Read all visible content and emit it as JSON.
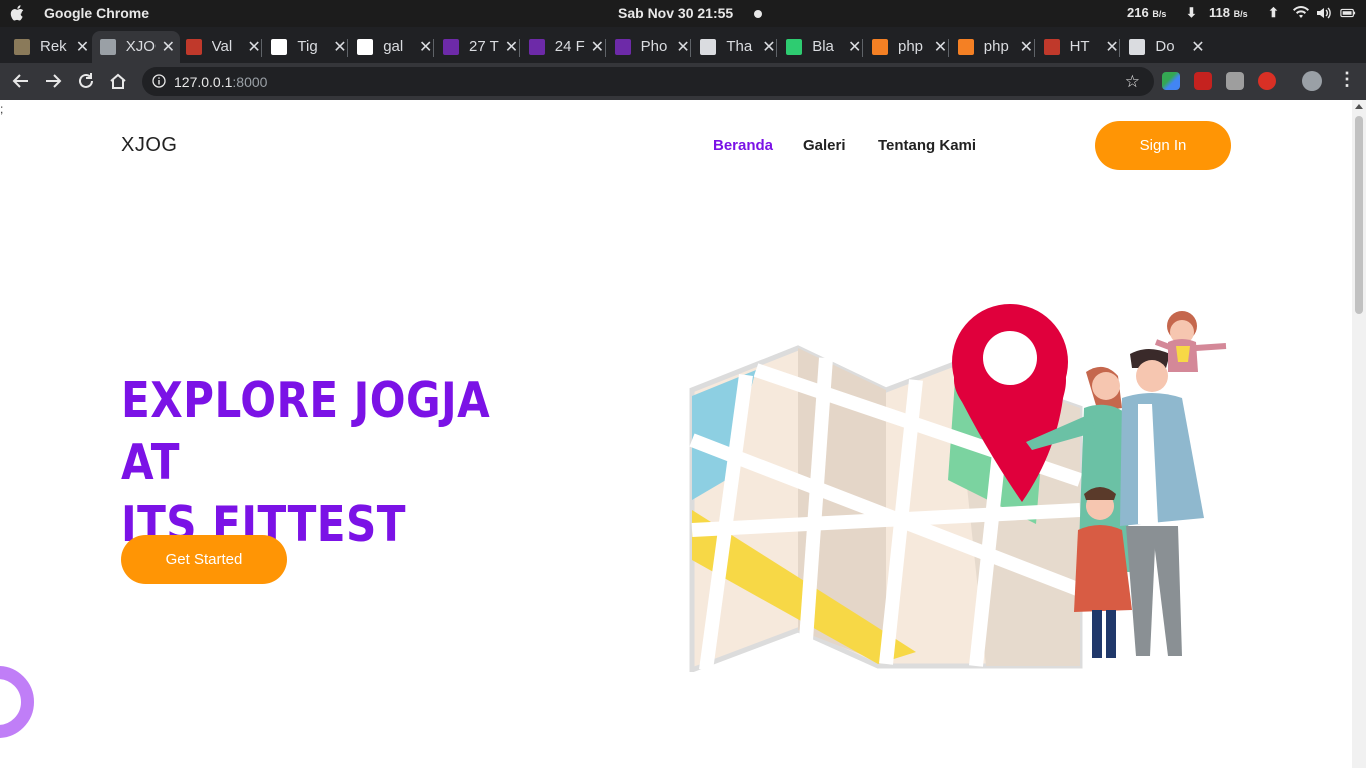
{
  "os": {
    "app_name": "Google Chrome",
    "clock": "Sab Nov 30  21:55",
    "net_down_value": "216",
    "net_down_unit": "B/s",
    "net_up_value": "118",
    "net_up_unit": "B/s"
  },
  "tabs": [
    {
      "title": "Rek",
      "favicon": "grid-icon",
      "color": "#8a7a5a"
    },
    {
      "title": "XJOG",
      "favicon": "globe-icon",
      "color": "#9aa0a6",
      "active": true
    },
    {
      "title": "Val",
      "favicon": "laravel-icon",
      "color": "#c0392b"
    },
    {
      "title": "Tig",
      "favicon": "medium-icon",
      "color": "#ffffff"
    },
    {
      "title": "gal",
      "favicon": "google-icon",
      "color": "#ffffff"
    },
    {
      "title": "27 T",
      "favicon": "colorlib-icon",
      "color": "#6d2aa8"
    },
    {
      "title": "24 F",
      "favicon": "colorlib-icon",
      "color": "#6d2aa8"
    },
    {
      "title": "Pho",
      "favicon": "colorlib-icon",
      "color": "#6d2aa8"
    },
    {
      "title": "Tha",
      "favicon": "wordpress-icon",
      "color": "#dadce0"
    },
    {
      "title": "Bla",
      "favicon": "bootstrap-icon",
      "color": "#2ecc71"
    },
    {
      "title": "php",
      "favicon": "stackoverflow-icon",
      "color": "#f48024"
    },
    {
      "title": "php",
      "favicon": "stackoverflow-icon",
      "color": "#f48024"
    },
    {
      "title": "HT",
      "favicon": "laravel-icon",
      "color": "#c0392b"
    },
    {
      "title": "Do",
      "favicon": "download-icon",
      "color": "#dadce0"
    }
  ],
  "toolbar": {
    "url_host": "127.0.0.1",
    "url_port": ":8000"
  },
  "site": {
    "stray_text": ";",
    "brand": "XJOG",
    "nav": [
      "Beranda",
      "Galeri",
      "Tentang Kami"
    ],
    "nav_active": "Beranda",
    "signin_label": "Sign In",
    "hero_line1": "EXPLORE JOGJA AT",
    "hero_line2": "ITS FITTEST",
    "cta_label": "Get Started"
  },
  "colors": {
    "accent_purple": "#7b12e6",
    "accent_orange": "#ff9505",
    "pin_red": "#e0003c",
    "deco_lavender": "#c07ef7"
  }
}
